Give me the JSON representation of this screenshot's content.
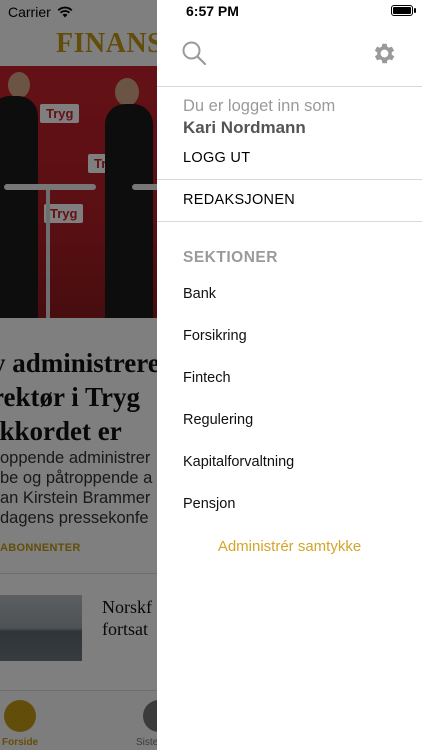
{
  "background": {
    "carrier": "Carrier",
    "masthead": "FINANS",
    "photo_banners": [
      "Tryg",
      "Tryg",
      "Tryg"
    ],
    "headline_lines": [
      "y administrere",
      "rektør i Tryg",
      "ikkordet er"
    ],
    "lead_lines": [
      "oppende administrer",
      "be og påtroppende a",
      "an Kirstein Brammer",
      "dagens pressekonfe"
    ],
    "subscriber_tag": "ABONNENTER",
    "thumb_title_lines": [
      "Norskf",
      "fortsat"
    ],
    "tabs": [
      "Forside",
      "Siste"
    ]
  },
  "menu": {
    "status_time": "6:57 PM",
    "logged_in_label": "Du er logget inn som",
    "user_name": "Kari Nordmann",
    "logout_label": "LOGG UT",
    "editorial_label": "REDAKSJONEN",
    "sections_heading": "SEKTIONER",
    "sections": [
      "Bank",
      "Forsikring",
      "Fintech",
      "Regulering",
      "Kapitalforvaltning",
      "Pensjon"
    ],
    "consent_label": "Administrér samtykke",
    "icons": {
      "search": "search-icon",
      "settings": "gear-icon",
      "wifi": "wifi-icon",
      "battery": "battery-icon"
    },
    "colors": {
      "accent": "#d4a52a",
      "muted": "#9a9a9a",
      "brand_gold": "#c79a14",
      "tryg_red": "#c8232c"
    }
  }
}
